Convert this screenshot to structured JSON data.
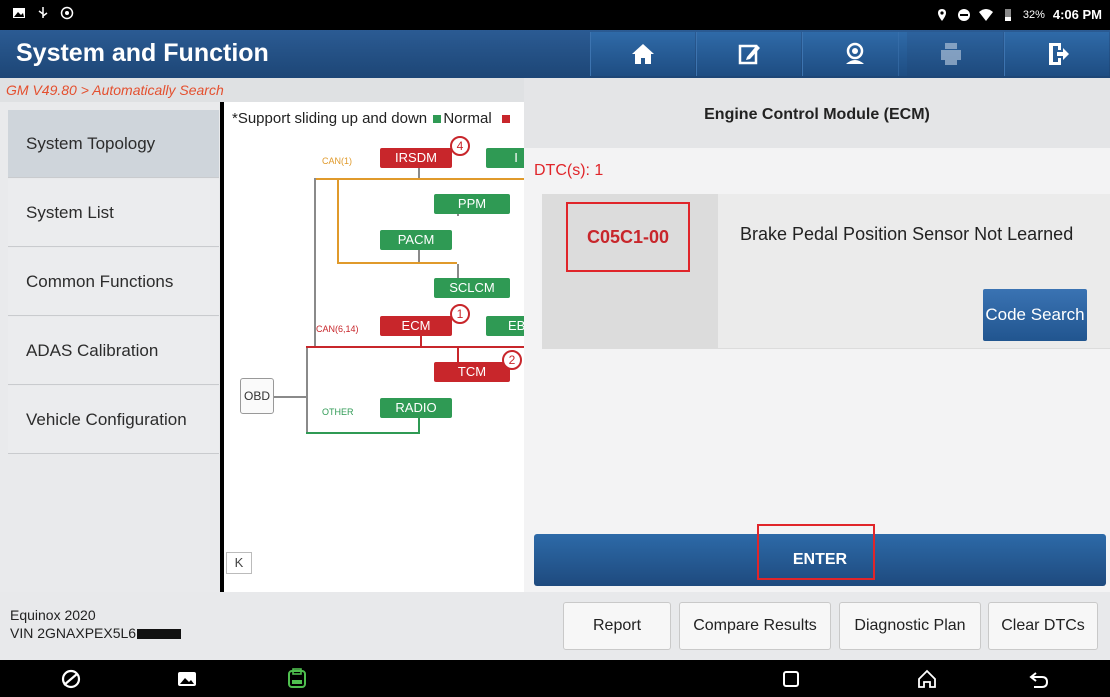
{
  "status": {
    "battery": "32%",
    "time": "4:06 PM"
  },
  "header": {
    "title": "System and Function",
    "buttons": [
      "home",
      "edit",
      "support",
      "print",
      "exit"
    ]
  },
  "breadcrumb": "GM V49.80 > Automatically Search",
  "sidebar": {
    "items": [
      {
        "label": "System Topology"
      },
      {
        "label": "System List"
      },
      {
        "label": "Common Functions"
      },
      {
        "label": "ADAS Calibration"
      },
      {
        "label": "Vehicle Configuration"
      }
    ]
  },
  "topology": {
    "hint": "*Support sliding up and down",
    "legend_normal": "Normal",
    "bus_can1": "CAN(1)",
    "bus_can614": "CAN(6,14)",
    "bus_other": "OTHER",
    "obd": "OBD",
    "collapse": "K",
    "nodes": {
      "irsdm": "IRSDM",
      "ppm": "PPM",
      "pacm": "PACM",
      "sclcm": "SCLCM",
      "ecm": "ECM",
      "eb": "EB",
      "tcm": "TCM",
      "radio": "RADIO",
      "cut1": "I"
    },
    "badges": {
      "irsdm": "4",
      "ecm": "1",
      "tcm": "2"
    },
    "colors": {
      "normal": "#2f9a54",
      "fault": "#c8262b",
      "can1": "#e09a2b",
      "can614": "#c8262b",
      "other": "#2f9a54"
    }
  },
  "panel": {
    "title": "Engine Control Module (ECM)",
    "dtc_count": "DTC(s): 1",
    "dtc": {
      "code": "C05C1-00",
      "description": "Brake Pedal Position Sensor Not Learned"
    },
    "code_search": "Code Search",
    "enter": "ENTER"
  },
  "footer": {
    "vehicle": "Equinox 2020",
    "vin": "VIN 2GNAXPEX5L6",
    "buttons": {
      "report": "Report",
      "compare": "Compare Results",
      "plan": "Diagnostic Plan",
      "clear": "Clear DTCs"
    }
  }
}
